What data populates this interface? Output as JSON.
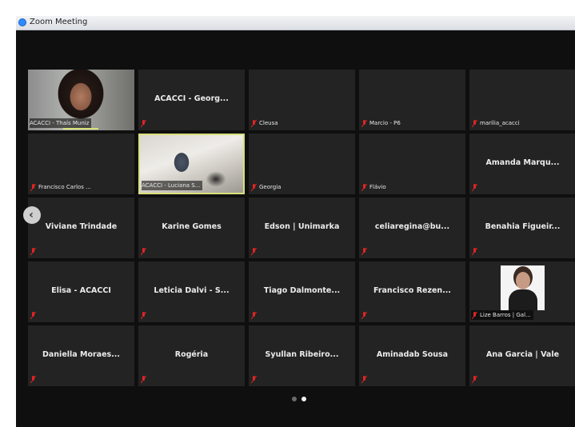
{
  "window": {
    "title": "Zoom Meeting",
    "icon": "zoom-icon"
  },
  "colors": {
    "active_speaker": "#d8e07a",
    "muted": "#e02424",
    "tile_bg": "#232323"
  },
  "participants": [
    {
      "name": "",
      "label": "ACACCI - Thaís Muniz",
      "type": "video",
      "muted": false
    },
    {
      "name": "ACACCI - Georg...",
      "label": "",
      "type": "name",
      "muted": true
    },
    {
      "name": "",
      "label": "Cleusa",
      "type": "blank",
      "muted": true
    },
    {
      "name": "",
      "label": "Marcio - P6",
      "type": "blank",
      "muted": true
    },
    {
      "name": "",
      "label": "marilia_acacci",
      "type": "blank",
      "muted": true
    },
    {
      "name": "",
      "label": "Francisco Carlos ...",
      "type": "blank",
      "muted": true
    },
    {
      "name": "",
      "label": "ACACCI - Luciana S...",
      "type": "video",
      "muted": false
    },
    {
      "name": "",
      "label": "Georgia",
      "type": "blank",
      "muted": true
    },
    {
      "name": "",
      "label": "Flávio",
      "type": "blank",
      "muted": true
    },
    {
      "name": "Amanda Marqu...",
      "label": "",
      "type": "name",
      "muted": true
    },
    {
      "name": "Viviane Trindade",
      "label": "",
      "type": "name",
      "muted": true
    },
    {
      "name": "Karine Gomes",
      "label": "",
      "type": "name",
      "muted": true
    },
    {
      "name": "Edson | Unimarka",
      "label": "",
      "type": "name",
      "muted": true
    },
    {
      "name": "celiaregina@bu...",
      "label": "",
      "type": "name",
      "muted": true
    },
    {
      "name": "Benahia Figueir...",
      "label": "",
      "type": "name",
      "muted": true
    },
    {
      "name": "Elisa - ACACCI",
      "label": "",
      "type": "name",
      "muted": true
    },
    {
      "name": "Leticia Dalvi - S...",
      "label": "",
      "type": "name",
      "muted": true
    },
    {
      "name": "Tiago Dalmonte...",
      "label": "",
      "type": "name",
      "muted": true
    },
    {
      "name": "Francisco Rezen...",
      "label": "",
      "type": "name",
      "muted": true
    },
    {
      "name": "",
      "label": "Lize Barros | Gal...",
      "type": "photo",
      "muted": true
    },
    {
      "name": "Daniella Moraes...",
      "label": "",
      "type": "name",
      "muted": true
    },
    {
      "name": "Rogéria",
      "label": "",
      "type": "name",
      "muted": true
    },
    {
      "name": "Syullan Ribeiro...",
      "label": "",
      "type": "name",
      "muted": true
    },
    {
      "name": "Aminadab Sousa",
      "label": "",
      "type": "name",
      "muted": true
    },
    {
      "name": "Ana Garcia | Vale",
      "label": "",
      "type": "name",
      "muted": true
    }
  ],
  "navigation": {
    "prev_icon": "chevron-left-icon",
    "page_current": 2,
    "page_total": 2
  }
}
